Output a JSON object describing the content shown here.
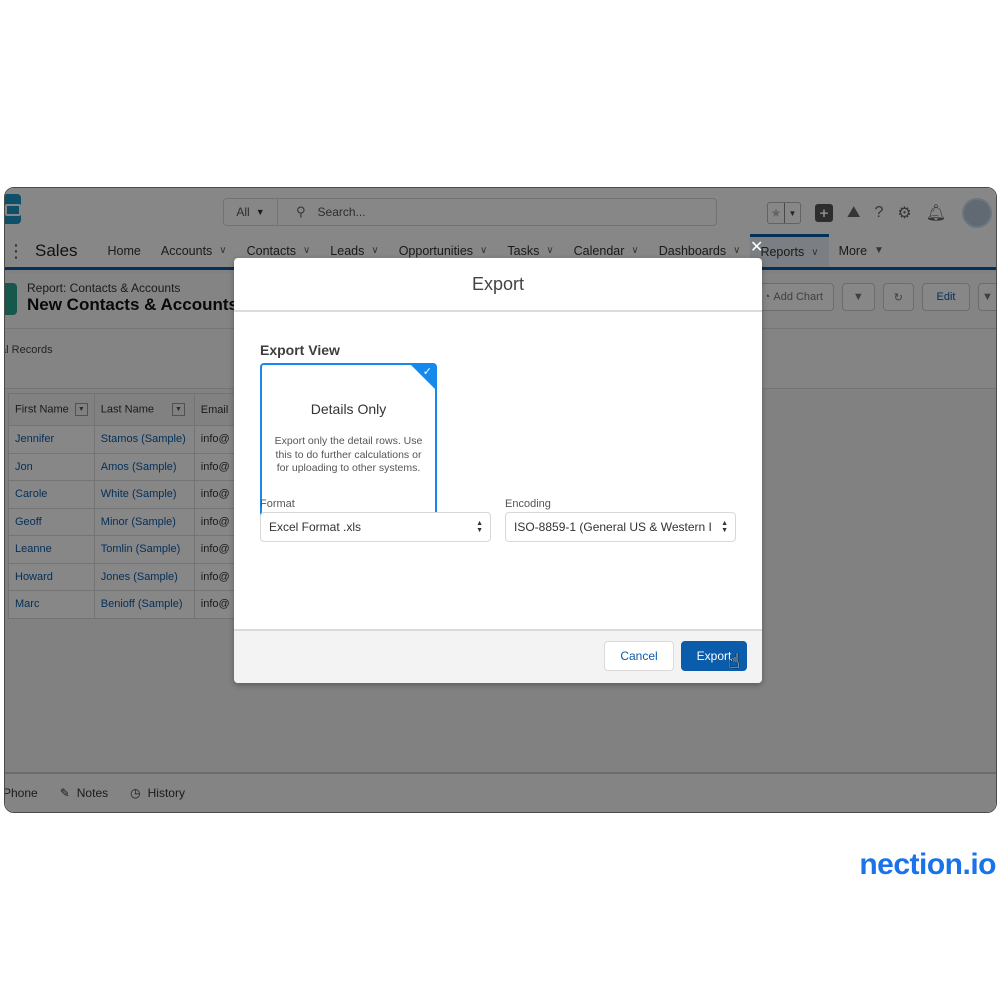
{
  "global_header": {
    "search_scope": "All",
    "search_placeholder": "Search..."
  },
  "nav": {
    "app_name": "Sales",
    "items": [
      {
        "label": "Home",
        "has_menu": false
      },
      {
        "label": "Accounts",
        "has_menu": true
      },
      {
        "label": "Contacts",
        "has_menu": true
      },
      {
        "label": "Leads",
        "has_menu": true
      },
      {
        "label": "Opportunities",
        "has_menu": true
      },
      {
        "label": "Tasks",
        "has_menu": true
      },
      {
        "label": "Calendar",
        "has_menu": true
      },
      {
        "label": "Dashboards",
        "has_menu": true
      },
      {
        "label": "Reports",
        "has_menu": true,
        "active": true
      },
      {
        "label": "More",
        "has_menu": true
      }
    ]
  },
  "page_header": {
    "eyebrow": "Report: Contacts & Accounts",
    "title": "New Contacts & Accounts",
    "actions": {
      "add_chart": "Add Chart",
      "edit": "Edit"
    }
  },
  "records_label": "tal Records",
  "table": {
    "columns": [
      "First Name",
      "Last Name",
      "Email"
    ],
    "rows": [
      {
        "first": "Jennifer",
        "last": "Stamos (Sample)",
        "email": "info@"
      },
      {
        "first": "Jon",
        "last": "Amos (Sample)",
        "email": "info@"
      },
      {
        "first": "Carole",
        "last": "White (Sample)",
        "email": "info@"
      },
      {
        "first": "Geoff",
        "last": "Minor (Sample)",
        "email": "info@"
      },
      {
        "first": "Leanne",
        "last": "Tomlin (Sample)",
        "email": "info@"
      },
      {
        "first": "Howard",
        "last": "Jones (Sample)",
        "email": "info@"
      },
      {
        "first": "Marc",
        "last": "Benioff (Sample)",
        "email": "info@"
      }
    ]
  },
  "bottom_bar": {
    "items": [
      "Phone",
      "Notes",
      "History"
    ]
  },
  "modal": {
    "title": "Export",
    "close_glyph": "✕",
    "export_view_label": "Export View",
    "card": {
      "title": "Details Only",
      "description": "Export only the detail rows. Use this to do further calculations or for uploading to other systems.",
      "selected": true
    },
    "format": {
      "label": "Format",
      "value": "Excel Format .xls"
    },
    "encoding": {
      "label": "Encoding",
      "value": "ISO-8859-1 (General US & Western I"
    },
    "cancel_label": "Cancel",
    "export_label": "Export"
  },
  "watermark": "nection.io",
  "colors": {
    "brand_blue": "#0b5cab",
    "selected_card": "#1589ee",
    "watermark": "#1a73e8"
  }
}
